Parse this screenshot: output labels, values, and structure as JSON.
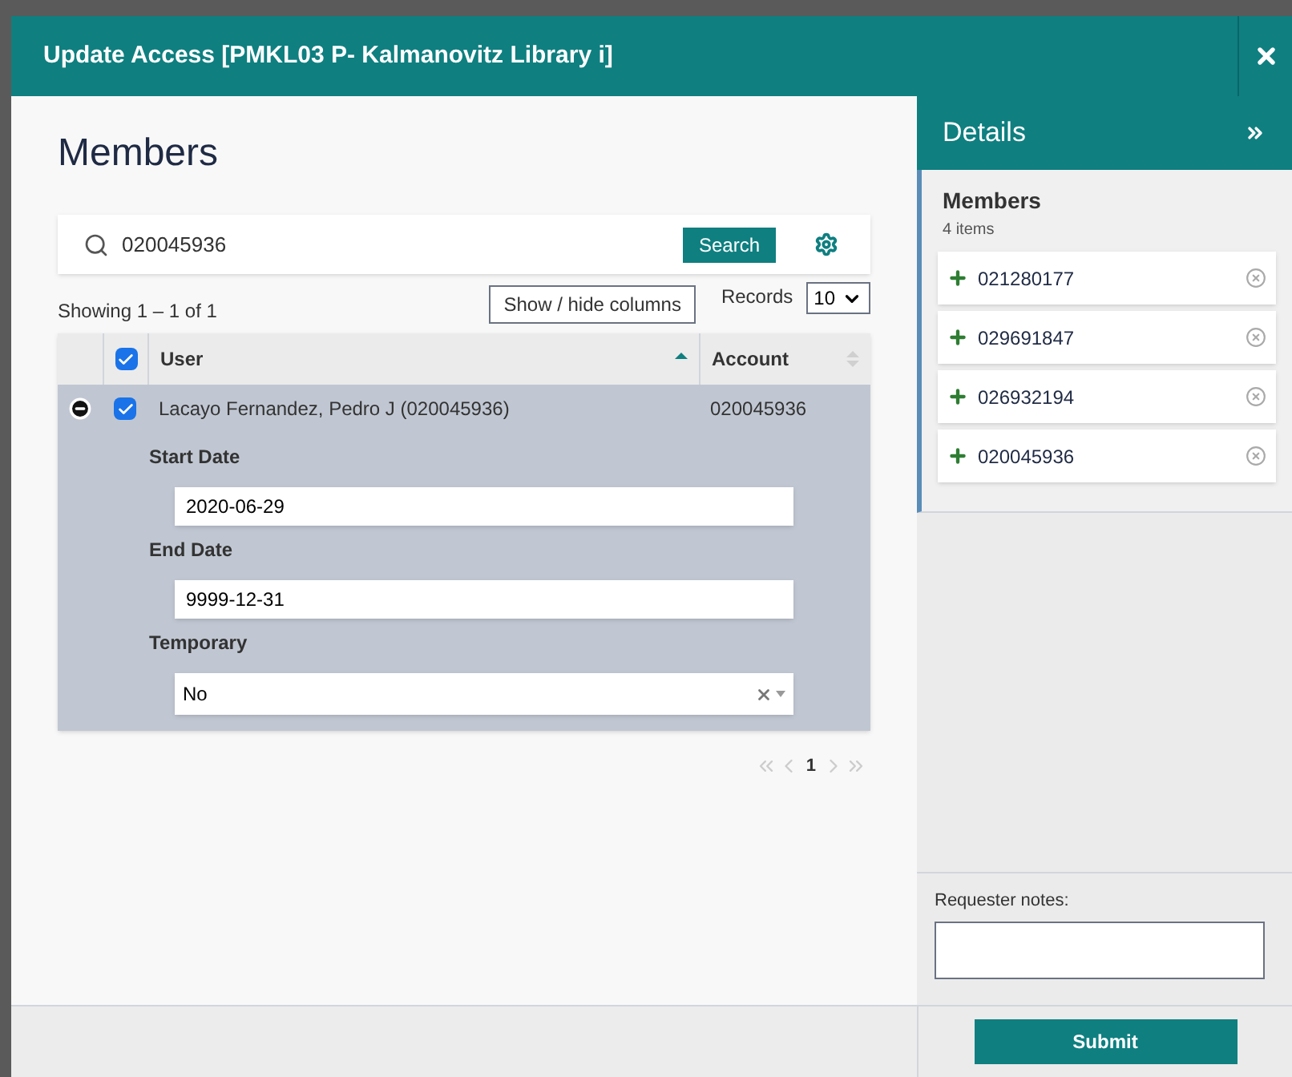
{
  "window": {
    "title": "Update Access [PMKL03 P- Kalmanovitz Library i]"
  },
  "main": {
    "heading": "Members",
    "search": {
      "value": "020045936",
      "button": "Search"
    },
    "showing": "Showing 1 – 1 of 1",
    "columns_button": "Show / hide columns",
    "records_label": "Records",
    "records_value": "10",
    "table": {
      "columns": [
        {
          "label": "User",
          "sorted": true
        },
        {
          "label": "Account",
          "sorted": false
        }
      ],
      "header_checked": true,
      "rows": [
        {
          "user": "Lacayo Fernandez, Pedro J (020045936)",
          "account": "020045936",
          "checked": true,
          "expanded": true,
          "fields": [
            {
              "kind": "text",
              "label": "Start Date",
              "value": "2020-06-29"
            },
            {
              "kind": "text",
              "label": "End Date",
              "value": "9999-12-31"
            },
            {
              "kind": "select",
              "label": "Temporary",
              "value": "No"
            }
          ]
        }
      ]
    },
    "pagination": {
      "page": "1"
    }
  },
  "details": {
    "title": "Details",
    "section": "Members",
    "count": "4 items",
    "items": [
      "021280177",
      "029691847",
      "026932194",
      "020045936"
    ],
    "notes_label": "Requester notes:",
    "submit": "Submit"
  }
}
